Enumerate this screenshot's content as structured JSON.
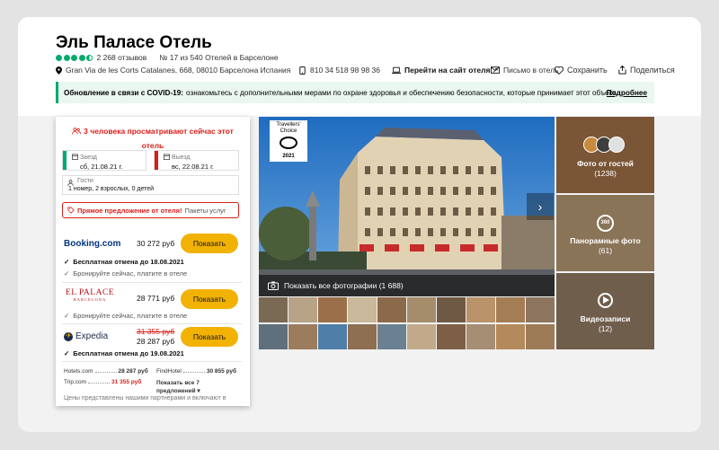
{
  "hotel": {
    "title": "Эль Паласе Отель",
    "reviews": "2 268 отзывов",
    "rank": "№ 17 из 540 Отелей в Барселоне",
    "address": "Gran Via de les Corts Catalanes, 668, 08010 Барселона Испания",
    "phone": "810 34 518 98 98 36",
    "website_label": "Перейти на сайт отеля",
    "email_label": "Письмо в отель",
    "save_label": "Сохранить",
    "share_label": "Поделиться",
    "rating": 4.5
  },
  "covid": {
    "title": "Обновление в связи с COVID-19:",
    "text": "ознакомьтесь с дополнительными мерами по охране здоровья и обеспечению безопасности, которые принимает этот объект.",
    "more": "Подробнее"
  },
  "booking": {
    "viewers": "3 человека просматривают сейчас этот отель",
    "checkin_label": "Заезд",
    "checkin_value": "сб, 21.08.21 г.",
    "checkout_label": "Выезд",
    "checkout_value": "вс, 22.08.21 г.",
    "guests_label": "Гости",
    "guests_value": "1 номер, 2 взрослых, 0 детей",
    "deal_red": "Прямое предложение от отеля!",
    "deal_gray": "Пакеты услуг",
    "offers": [
      {
        "logo": "Booking.com",
        "price": "30 272 руб",
        "button": "Показать",
        "note1": "Бесплатная отмена до 18.08.2021",
        "note2": "Бронируйте сейчас, платите в отеле"
      },
      {
        "logo": "EL PALACE",
        "logo_sub": "BARCELONA",
        "price": "28 771 руб",
        "button": "Показать",
        "note1": "Бронируйте сейчас, платите в отеле"
      },
      {
        "logo": "Expedia",
        "old_price": "31 355 руб",
        "price": "28 287 руб",
        "button": "Показать",
        "note1": "Бесплатная отмена до 19.08.2021"
      }
    ],
    "mini": [
      {
        "name": "Hotels.com",
        "price": "28 287 руб"
      },
      {
        "name": "FindHotel",
        "price": "30 855 руб"
      },
      {
        "name": "Trip.com",
        "price": "31 355 руб"
      }
    ],
    "show_all": "Показать все 7 предложений",
    "footer": "Цены представлены нашими партнерами и включают в"
  },
  "gallery": {
    "award_title": "Travellers' Choice",
    "award_year": "2021",
    "show_all_photos": "Показать все фотографии (1 688)",
    "guest_photos": "Фото от гостей",
    "guest_photos_count": "(1238)",
    "panorama": "Панорамные фото",
    "panorama_count": "(61)",
    "videos": "Видеозаписи",
    "videos_count": "(12)"
  },
  "colors": {
    "green": "#00aa6c",
    "red": "#d91e18",
    "yellow_button": "#f2b203",
    "booking_blue": "#003580",
    "elpalace_red": "#b4121b"
  }
}
